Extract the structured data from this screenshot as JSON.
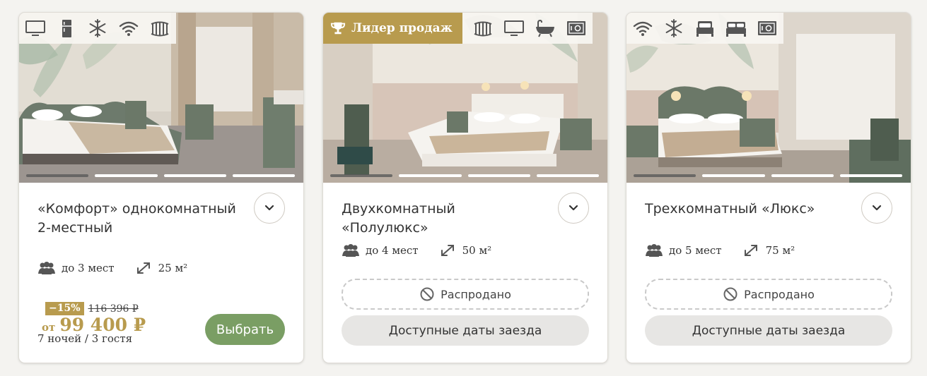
{
  "cards": [
    {
      "leader_badge": null,
      "amenities": [
        "tv-icon",
        "fridge-icon",
        "snowflake-icon",
        "wifi-icon",
        "heater-icon"
      ],
      "title": "«Комфорт» однокомнатный 2-местный",
      "guests": "до 3 мест",
      "area": "25 м²",
      "discount": "−15%",
      "old_price": "116 396 ₽",
      "price_prefix": "от",
      "price": "99 400 ₽",
      "stay_info": "7 ночей / 3 гостя",
      "select_label": "Выбрать",
      "gallery_active_index": 0,
      "gallery_count": 4
    },
    {
      "leader_badge": "Лидер продаж",
      "amenities": [
        "heater-icon",
        "tv-icon",
        "bathtub-icon",
        "safe-icon"
      ],
      "title": "Двухкомнатный «Полулюкс»",
      "guests": "до 4 мест",
      "area": "50 м²",
      "soldout_label": "Распродано",
      "dates_label": "Доступные даты заезда",
      "gallery_active_index": 0,
      "gallery_count": 4
    },
    {
      "leader_badge": null,
      "amenities": [
        "wifi-icon",
        "snowflake-icon",
        "single-bed-icon",
        "double-bed-icon",
        "safe-icon"
      ],
      "title": "Трехкомнатный «Люкс»",
      "guests": "до 5 мест",
      "area": "75 м²",
      "soldout_label": "Распродано",
      "dates_label": "Доступные даты заезда",
      "gallery_active_index": 0,
      "gallery_count": 4
    }
  ],
  "colors": {
    "gold": "#b89b4e",
    "green_button": "#7a9e64",
    "background": "#f4f3f0"
  }
}
